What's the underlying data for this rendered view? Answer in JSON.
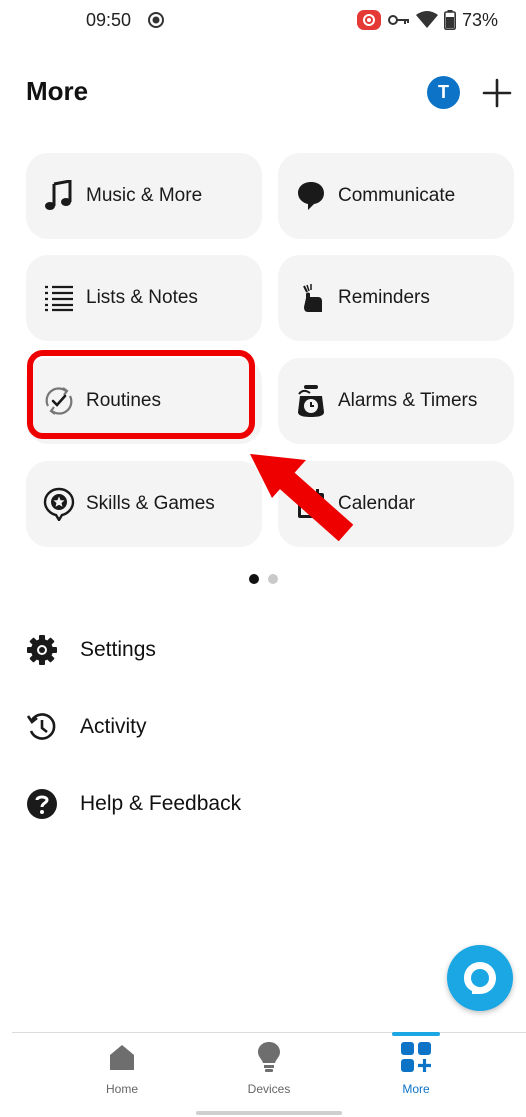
{
  "status_bar": {
    "time": "09:50",
    "battery": "73%"
  },
  "header": {
    "title": "More",
    "avatar_initial": "T"
  },
  "tiles": [
    {
      "label": "Music & More",
      "icon": "music-note-icon"
    },
    {
      "label": "Communicate",
      "icon": "speech-bubble-icon"
    },
    {
      "label": "Lists & Notes",
      "icon": "list-icon"
    },
    {
      "label": "Reminders",
      "icon": "reminder-hand-icon"
    },
    {
      "label": "Routines",
      "icon": "routine-check-icon"
    },
    {
      "label": "Alarms & Timers",
      "icon": "alarm-clock-icon"
    },
    {
      "label": "Skills & Games",
      "icon": "skills-star-icon"
    },
    {
      "label": "Calendar",
      "icon": "calendar-icon"
    }
  ],
  "list": [
    {
      "label": "Settings",
      "icon": "gear-icon"
    },
    {
      "label": "Activity",
      "icon": "history-icon"
    },
    {
      "label": "Help & Feedback",
      "icon": "help-icon"
    }
  ],
  "nav": [
    {
      "label": "Home",
      "icon": "home-icon"
    },
    {
      "label": "Devices",
      "icon": "lightbulb-icon"
    },
    {
      "label": "More",
      "icon": "more-grid-icon"
    }
  ],
  "colors": {
    "accent": "#1aa7e4",
    "avatar": "#0c73c7",
    "highlight": "#ee0000",
    "tile_bg": "#f4f4f5"
  }
}
